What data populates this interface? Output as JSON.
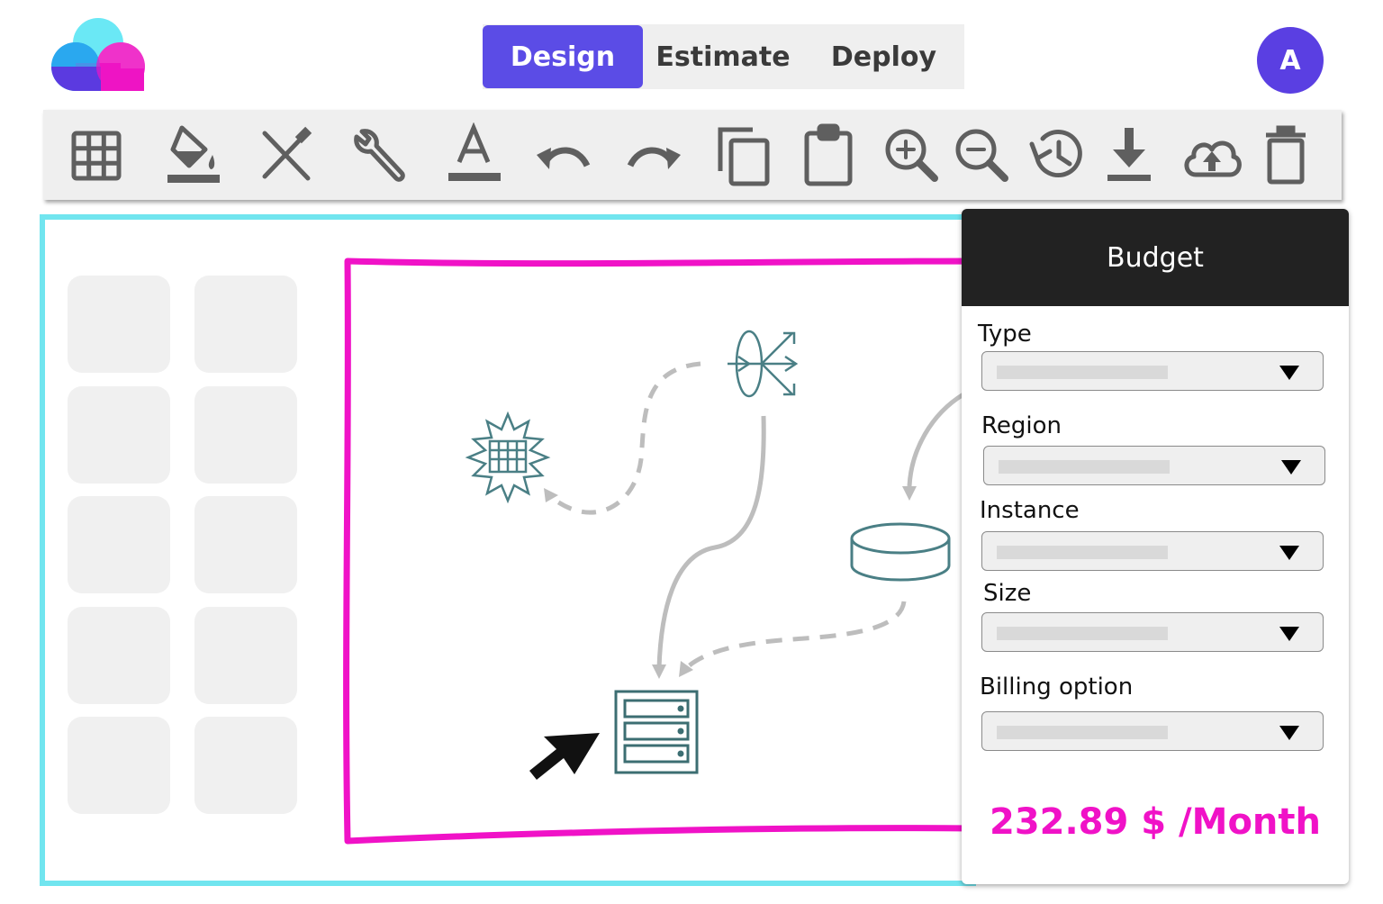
{
  "header": {
    "tabs": [
      {
        "label": "Design",
        "active": true
      },
      {
        "label": "Estimate",
        "active": false
      },
      {
        "label": "Deploy",
        "active": false
      }
    ],
    "avatar_initial": "A"
  },
  "toolbar": {
    "tools": [
      "grid-icon",
      "fill-bucket-icon",
      "tools-icon",
      "wrench-icon",
      "text-color-icon",
      "undo-icon",
      "redo-icon",
      "copy-icon",
      "paste-icon",
      "zoom-in-icon",
      "zoom-out-icon",
      "history-icon",
      "download-icon",
      "cloud-upload-icon",
      "trash-icon"
    ]
  },
  "canvas": {
    "nodes": [
      "gear-node-icon",
      "load-balancer-icon",
      "database-icon",
      "server-icon"
    ],
    "cursor": "cursor-arrow-icon"
  },
  "colors": {
    "accent": "#5b4ce6",
    "workspace_border": "#71e5ef",
    "frame": "#f012c7",
    "price": "#f012c7",
    "node": "#4a7f85"
  },
  "budget": {
    "title": "Budget",
    "fields": [
      {
        "label": "Type"
      },
      {
        "label": "Region"
      },
      {
        "label": "Instance"
      },
      {
        "label": "Size"
      },
      {
        "label": "Billing option"
      }
    ],
    "price": "232.89 $ /Month"
  }
}
